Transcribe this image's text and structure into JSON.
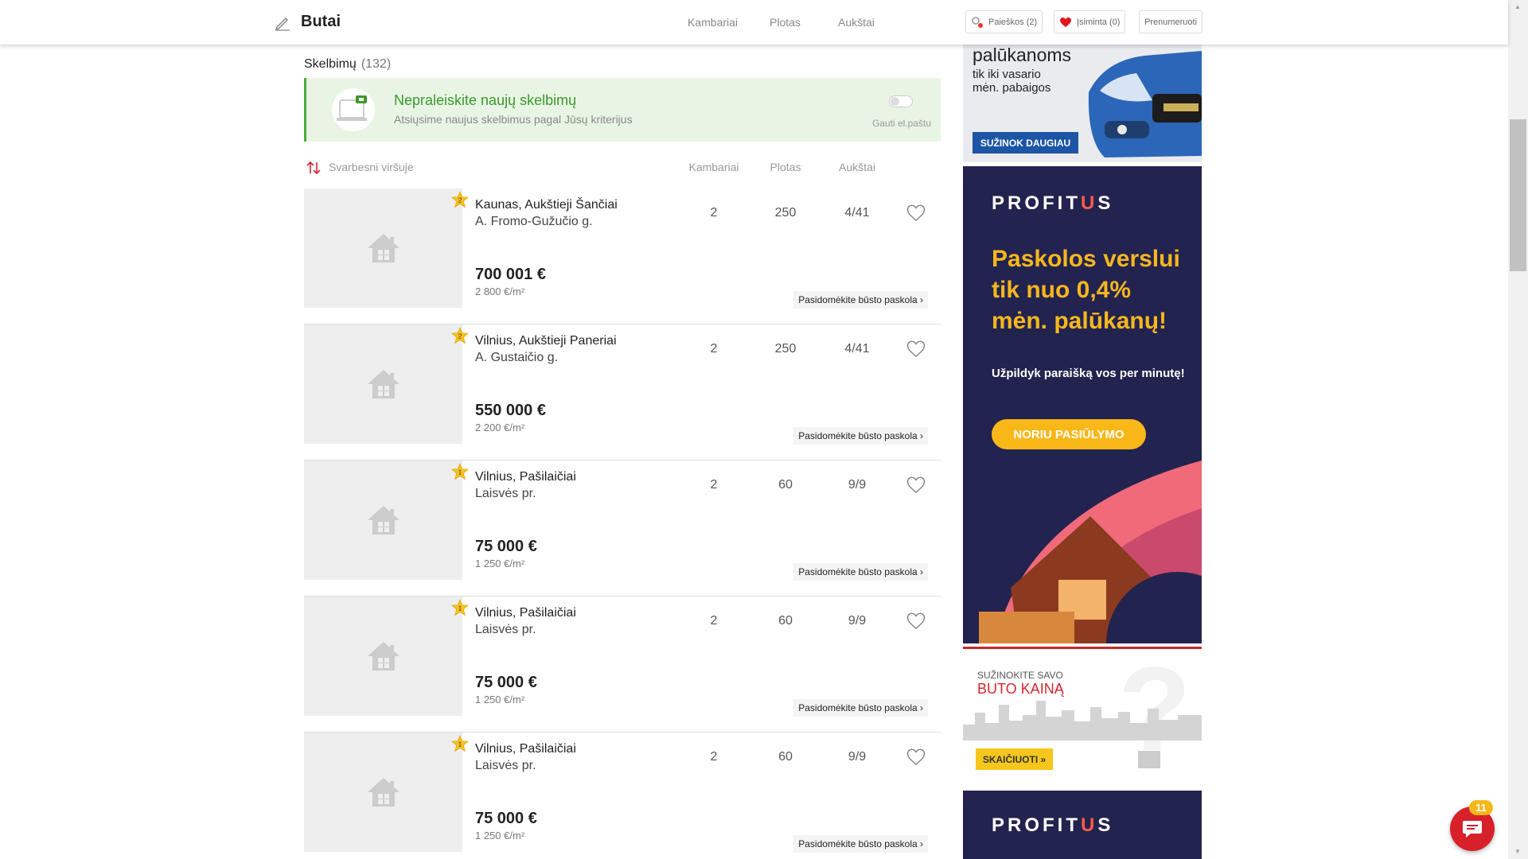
{
  "header": {
    "title": "Butai",
    "columns": [
      "Kambariai",
      "Plotas",
      "Aukštai"
    ],
    "buttons": {
      "searches": "Paieškos (2)",
      "saved": "Įsiminta (0)",
      "subscribe": "Prenumeruoti"
    }
  },
  "listings_header": {
    "label": "Skelbimų",
    "count": "(132)"
  },
  "subscribe_banner": {
    "title": "Nepraleiskite naujų skelbimų",
    "subtitle": "Atsiųsime naujus skelbimus pagal Jūsų kriterijus",
    "toggle_label": "Gauti el.paštu",
    "toggle_on": false
  },
  "sort": {
    "label": "Svarbesni viršuje",
    "columns": [
      "Kambariai",
      "Plotas",
      "Aukštai"
    ]
  },
  "listings": [
    {
      "badge": "2",
      "location": "Kaunas, Aukštieji Šančiai",
      "street": "A. Fromo-Gužučio g.",
      "rooms": "2",
      "area": "250",
      "floors": "4/41",
      "price": "700 001 €",
      "price_per_m2": "2 800 €/m²",
      "loan": "Pasidomėkite būsto paskola ›"
    },
    {
      "badge": "2",
      "location": "Vilnius, Aukštieji Paneriai",
      "street": "A. Gustaičio g.",
      "rooms": "2",
      "area": "250",
      "floors": "4/41",
      "price": "550 000 €",
      "price_per_m2": "2 200 €/m²",
      "loan": "Pasidomėkite būsto paskola ›"
    },
    {
      "badge": "1",
      "location": "Vilnius, Pašilaičiai",
      "street": "Laisvės pr.",
      "rooms": "2",
      "area": "60",
      "floors": "9/9",
      "price": "75 000 €",
      "price_per_m2": "1 250 €/m²",
      "loan": "Pasidomėkite būsto paskola ›"
    },
    {
      "badge": "1",
      "location": "Vilnius, Pašilaičiai",
      "street": "Laisvės pr.",
      "rooms": "2",
      "area": "60",
      "floors": "9/9",
      "price": "75 000 €",
      "price_per_m2": "1 250 €/m²",
      "loan": "Pasidomėkite būsto paskola ›"
    },
    {
      "badge": "1",
      "location": "Vilnius, Pašilaičiai",
      "street": "Laisvės pr.",
      "rooms": "2",
      "area": "60",
      "floors": "9/9",
      "price": "75 000 €",
      "price_per_m2": "1 250 €/m²",
      "loan": "Pasidomėkite būsto paskola ›"
    }
  ],
  "ads": {
    "car": {
      "line1": "palūkanoms",
      "line2": "tik iki vasario",
      "line3": "mėn. pabaigos",
      "button": "SUŽINOK DAUGIAU"
    },
    "profitus": {
      "logo_a": "PROFIT",
      "logo_u": "U",
      "logo_b": "S",
      "headline": "Paskolos verslui tik nuo 0,4% mėn. palūkanų!",
      "sub": "Užpildyk paraišką vos per minutę!",
      "button": "NORIU PASIŪLYMO"
    },
    "price": {
      "line1": "SUŽINOKITE SAVO",
      "line2": "BUTO KAINĄ",
      "button": "SKAIČIUOTI »"
    }
  },
  "chat": {
    "badge": "11"
  },
  "colors": {
    "green": "#4cab3c",
    "red": "#d8202a",
    "navy": "#23234f",
    "gold": "#f7b71e"
  }
}
